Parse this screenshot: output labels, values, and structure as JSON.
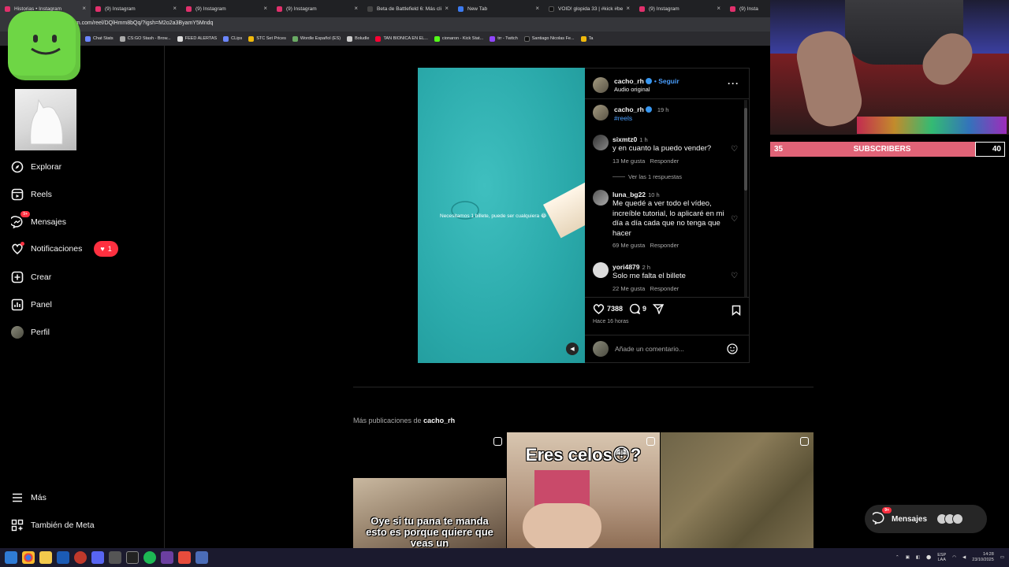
{
  "browser": {
    "tabs": [
      {
        "title": "Historias • Instagram",
        "color": "#e1306c"
      },
      {
        "title": "(9) Instagram",
        "color": "#e1306c"
      },
      {
        "title": "(9) Instagram",
        "color": "#e1306c"
      },
      {
        "title": "(9) Instagram",
        "color": "#e1306c"
      },
      {
        "title": "Beta de Battlefield 6: Más cli",
        "color": "#222"
      },
      {
        "title": "New Tab",
        "color": "#3c7bf0"
      },
      {
        "title": "VOID! glopida 33 | #kick #be",
        "color": "#111"
      },
      {
        "title": "(9) Instagram",
        "color": "#e1306c"
      },
      {
        "title": "(9) Insta",
        "color": "#e1306c"
      }
    ],
    "url": "am.com/reel/DQlHmm8bQq/?igsh=M2o2a3ByamY5Mndq",
    "bookmarks": [
      "Chat Stats",
      "CS:GO Stash - Brow...",
      "FEED ALERTAS",
      "CLips",
      "STC Set Prices",
      "Wordle Español (ES)",
      "Boludle",
      "TAN BIONICA EN EL...",
      "cionaron - Kick Stat...",
      "trr - Twitch",
      "Santiago Nicolas Fe...",
      "Ta"
    ]
  },
  "nav": {
    "items": [
      {
        "label": "Explorar",
        "icon": "compass-icon"
      },
      {
        "label": "Reels",
        "icon": "reels-icon"
      },
      {
        "label": "Mensajes",
        "icon": "messenger-icon",
        "badge": "9+"
      },
      {
        "label": "Notificaciones",
        "icon": "heart-icon",
        "pill_count": "1"
      },
      {
        "label": "Crear",
        "icon": "plus-square-icon"
      },
      {
        "label": "Panel",
        "icon": "chart-icon"
      },
      {
        "label": "Perfil",
        "icon": "profile-avatar"
      }
    ],
    "bottom": [
      {
        "label": "Más",
        "icon": "menu-icon"
      },
      {
        "label": "También de Meta",
        "icon": "meta-grid-icon"
      }
    ]
  },
  "reel": {
    "caption_overlay": "Necesitamos 1 billete, puede ser cualquiera 😂",
    "author": "cacho_rh",
    "follow_label": "• Seguir",
    "audio": "Audio original",
    "post": {
      "user": "cacho_rh",
      "time": "19 h",
      "tag": "#reels"
    },
    "comments": [
      {
        "user": "sixmtz0",
        "time": "1 h",
        "text": "y en cuanto la puedo vender?",
        "likes": "13 Me gusta",
        "reply": "Responder",
        "view_replies": "Ver las 1 respuestas"
      },
      {
        "user": "luna_bg22",
        "time": "10 h",
        "text": "Me quedé a ver todo el vídeo, increíble tutorial, lo aplicaré en mi día a día cada que no tenga que hacer",
        "likes": "69 Me gusta",
        "reply": "Responder"
      },
      {
        "user": "yori4879",
        "time": "2 h",
        "text": "Solo me falta el billete",
        "likes": "22 Me gusta",
        "reply": "Responder"
      }
    ],
    "like_count": "7388",
    "comment_count": "9",
    "posted": "Hace 16 horas",
    "comment_placeholder": "Añade un comentario..."
  },
  "more": {
    "prefix": "Más publicaciones de",
    "user": "cacho_rh",
    "thumbs": [
      {
        "text": "Oye si tu pana te manda esto es porque quiere que veas un"
      },
      {
        "text": "Eres celos😳?"
      },
      {
        "text": ""
      }
    ]
  },
  "overlay": {
    "subs_current": "35",
    "subs_label": "SUBSCRIBERS",
    "subs_goal": "40",
    "messages_label": "Mensajes",
    "messages_badge": "9+"
  },
  "taskbar": {
    "lang": "ESP\nLAA",
    "time": "14:28",
    "date": "23/10/2025"
  },
  "colors": {
    "accent_blue": "#4a9fff",
    "notification_red": "#ff3040",
    "sub_bar": "#e06377"
  }
}
